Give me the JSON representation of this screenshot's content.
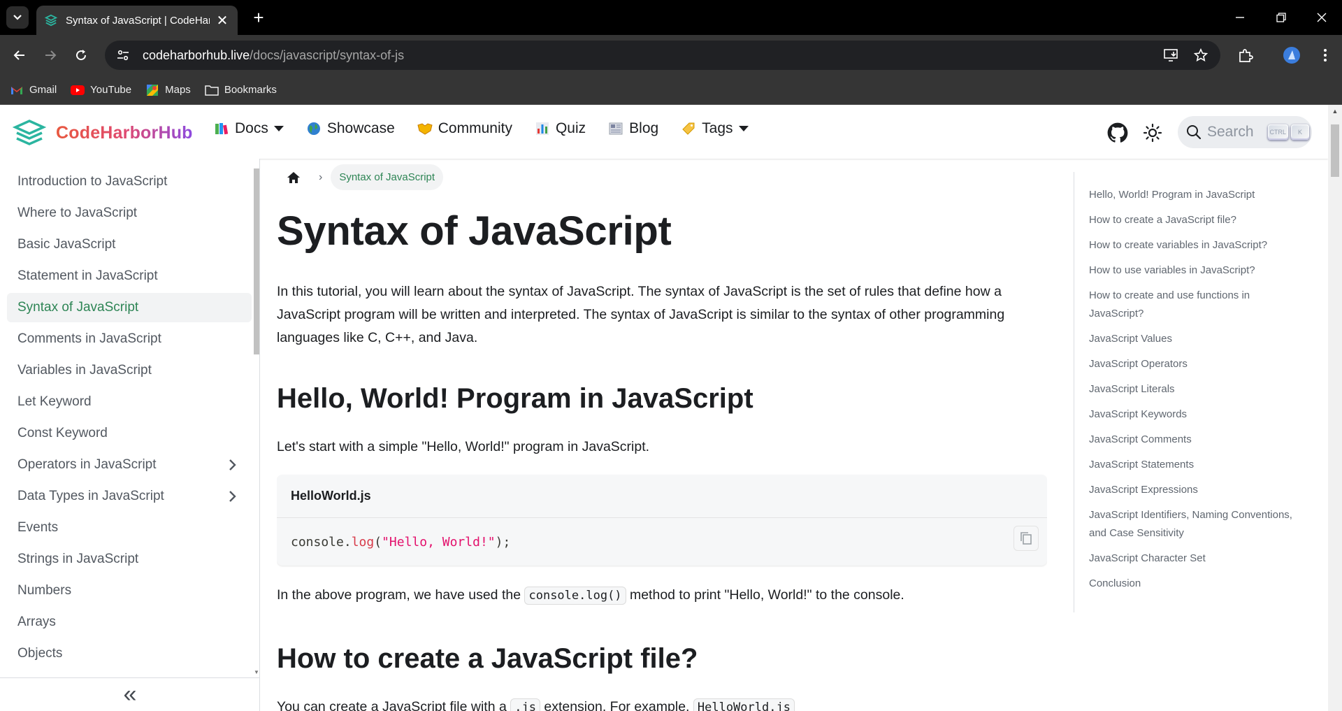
{
  "browser": {
    "tab_title": "Syntax of JavaScript | CodeHarb",
    "url_host": "codeharborhub.live",
    "url_path": "/docs/javascript/syntax-of-js",
    "bookmarks": [
      {
        "label": "Gmail",
        "icon": "gmail-icon"
      },
      {
        "label": "YouTube",
        "icon": "youtube-icon"
      },
      {
        "label": "Maps",
        "icon": "maps-icon"
      },
      {
        "label": "Bookmarks",
        "icon": "folder-icon"
      }
    ]
  },
  "site": {
    "brand": "CodeHarborHub",
    "nav": [
      {
        "label": "Docs",
        "icon": "books-icon",
        "dropdown": true
      },
      {
        "label": "Showcase",
        "icon": "globe-icon",
        "dropdown": false
      },
      {
        "label": "Community",
        "icon": "handshake-icon",
        "dropdown": false
      },
      {
        "label": "Quiz",
        "icon": "chart-icon",
        "dropdown": false
      },
      {
        "label": "Blog",
        "icon": "newspaper-icon",
        "dropdown": false
      },
      {
        "label": "Tags",
        "icon": "tag-icon",
        "dropdown": true
      }
    ],
    "search_placeholder": "Search",
    "search_keys": [
      "CTRL",
      "K"
    ]
  },
  "sidebar": {
    "items": [
      {
        "label": "Introduction to JavaScript",
        "active": false,
        "expandable": false
      },
      {
        "label": "Where to JavaScript",
        "active": false,
        "expandable": false
      },
      {
        "label": "Basic JavaScript",
        "active": false,
        "expandable": false
      },
      {
        "label": "Statement in JavaScript",
        "active": false,
        "expandable": false
      },
      {
        "label": "Syntax of JavaScript",
        "active": true,
        "expandable": false
      },
      {
        "label": "Comments in JavaScript",
        "active": false,
        "expandable": false
      },
      {
        "label": "Variables in JavaScript",
        "active": false,
        "expandable": false
      },
      {
        "label": "Let Keyword",
        "active": false,
        "expandable": false
      },
      {
        "label": "Const Keyword",
        "active": false,
        "expandable": false
      },
      {
        "label": "Operators in JavaScript",
        "active": false,
        "expandable": true
      },
      {
        "label": "Data Types in JavaScript",
        "active": false,
        "expandable": true
      },
      {
        "label": "Events",
        "active": false,
        "expandable": false
      },
      {
        "label": "Strings in JavaScript",
        "active": false,
        "expandable": false
      },
      {
        "label": "Numbers",
        "active": false,
        "expandable": false
      },
      {
        "label": "Arrays",
        "active": false,
        "expandable": false
      },
      {
        "label": "Objects",
        "active": false,
        "expandable": false
      }
    ],
    "collapse_glyph": "«"
  },
  "main": {
    "breadcrumb": "Syntax of JavaScript",
    "title": "Syntax of JavaScript",
    "intro": "In this tutorial, you will learn about the syntax of JavaScript. The syntax of JavaScript is the set of rules that define how a JavaScript program will be written and interpreted. The syntax of JavaScript is similar to the syntax of other programming languages like C, C++, and Java.",
    "section1_title": "Hello, World! Program in JavaScript",
    "section1_text": "Let's start with a simple \"Hello, World!\" program in JavaScript.",
    "code": {
      "filename": "HelloWorld.js",
      "obj": "console",
      "dot": ".",
      "method": "log",
      "open": "(",
      "arg": "\"Hello, World!\"",
      "close": ");"
    },
    "after_code_pre": "In the above program, we have used the ",
    "after_code_code": "console.log()",
    "after_code_post": " method to print \"Hello, World!\" to the console.",
    "section2_title": "How to create a JavaScript file?",
    "section2_pre": "You can create a JavaScript file with a ",
    "section2_code1": ".js",
    "section2_mid": " extension. For example, ",
    "section2_code2": "HelloWorld.js"
  },
  "toc": [
    "Hello, World! Program in JavaScript",
    "How to create a JavaScript file?",
    "How to create variables in JavaScript?",
    "How to use variables in JavaScript?",
    "How to create and use functions in JavaScript?",
    "JavaScript Values",
    "JavaScript Operators",
    "JavaScript Literals",
    "JavaScript Keywords",
    "JavaScript Comments",
    "JavaScript Statements",
    "JavaScript Expressions",
    "JavaScript Identifiers, Naming Conventions, and Case Sensitivity",
    "JavaScript Character Set",
    "Conclusion"
  ]
}
